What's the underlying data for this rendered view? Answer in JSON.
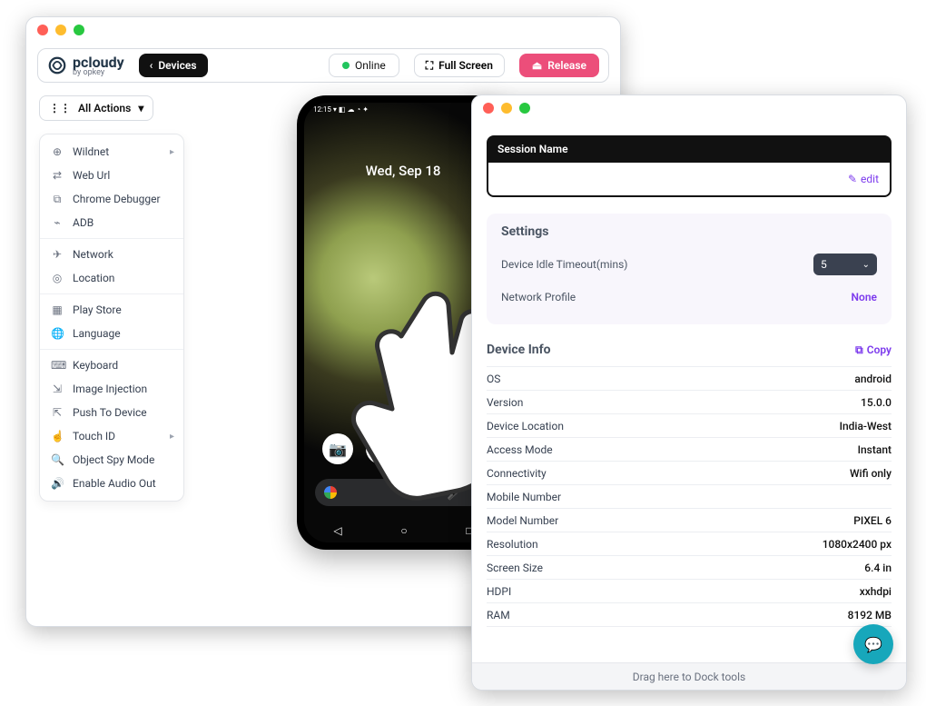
{
  "logo": {
    "brand": "pcloudy",
    "byline": "by opkey"
  },
  "toolbar": {
    "devices_label": "Devices",
    "online_label": "Online",
    "fullscreen_label": "Full Screen",
    "release_label": "Release"
  },
  "all_actions_label": "All Actions",
  "actions_groups": [
    [
      {
        "icon": "⊕",
        "label": "Wildnet",
        "has_sub": true
      },
      {
        "icon": "⇄",
        "label": "Web Url"
      },
      {
        "icon": "⧉",
        "label": "Chrome Debugger"
      },
      {
        "icon": "⌁",
        "label": "ADB"
      }
    ],
    [
      {
        "icon": "✈",
        "label": "Network"
      },
      {
        "icon": "◎",
        "label": "Location"
      }
    ],
    [
      {
        "icon": "▦",
        "label": "Play Store"
      },
      {
        "icon": "🌐",
        "label": "Language"
      }
    ],
    [
      {
        "icon": "⌨",
        "label": "Keyboard"
      },
      {
        "icon": "⇲",
        "label": "Image Injection"
      },
      {
        "icon": "⇱",
        "label": "Push To Device"
      },
      {
        "icon": "☝",
        "label": "Touch ID",
        "has_sub": true
      },
      {
        "icon": "🔍",
        "label": "Object Spy Mode"
      },
      {
        "icon": "🔊",
        "label": "Enable Audio Out"
      }
    ]
  ],
  "phone": {
    "status_left": "12:15  ▾ ◧ ☁ ◔ ✦",
    "status_right": "◢ ▮",
    "date": "Wed, Sep 18"
  },
  "panel": {
    "session_name_title": "Session Name",
    "edit_label": "edit",
    "settings_title": "Settings",
    "settings": {
      "idle_label": "Device Idle Timeout(mins)",
      "idle_value": "5",
      "profile_label": "Network Profile",
      "profile_value": "None"
    },
    "device_info_title": "Device Info",
    "copy_label": "Copy",
    "info": [
      {
        "k": "OS",
        "v": "android"
      },
      {
        "k": "Version",
        "v": "15.0.0"
      },
      {
        "k": "Device Location",
        "v": "India-West"
      },
      {
        "k": "Access Mode",
        "v": "Instant"
      },
      {
        "k": "Connectivity",
        "v": "Wifi only"
      },
      {
        "k": "Mobile Number",
        "v": ""
      },
      {
        "k": "Model Number",
        "v": "PIXEL 6"
      },
      {
        "k": "Resolution",
        "v": "1080x2400 px"
      },
      {
        "k": "Screen Size",
        "v": "6.4 in"
      },
      {
        "k": "HDPI",
        "v": "xxhdpi"
      },
      {
        "k": "RAM",
        "v": "8192 MB"
      }
    ],
    "dock_hint": "Drag here to Dock tools"
  }
}
